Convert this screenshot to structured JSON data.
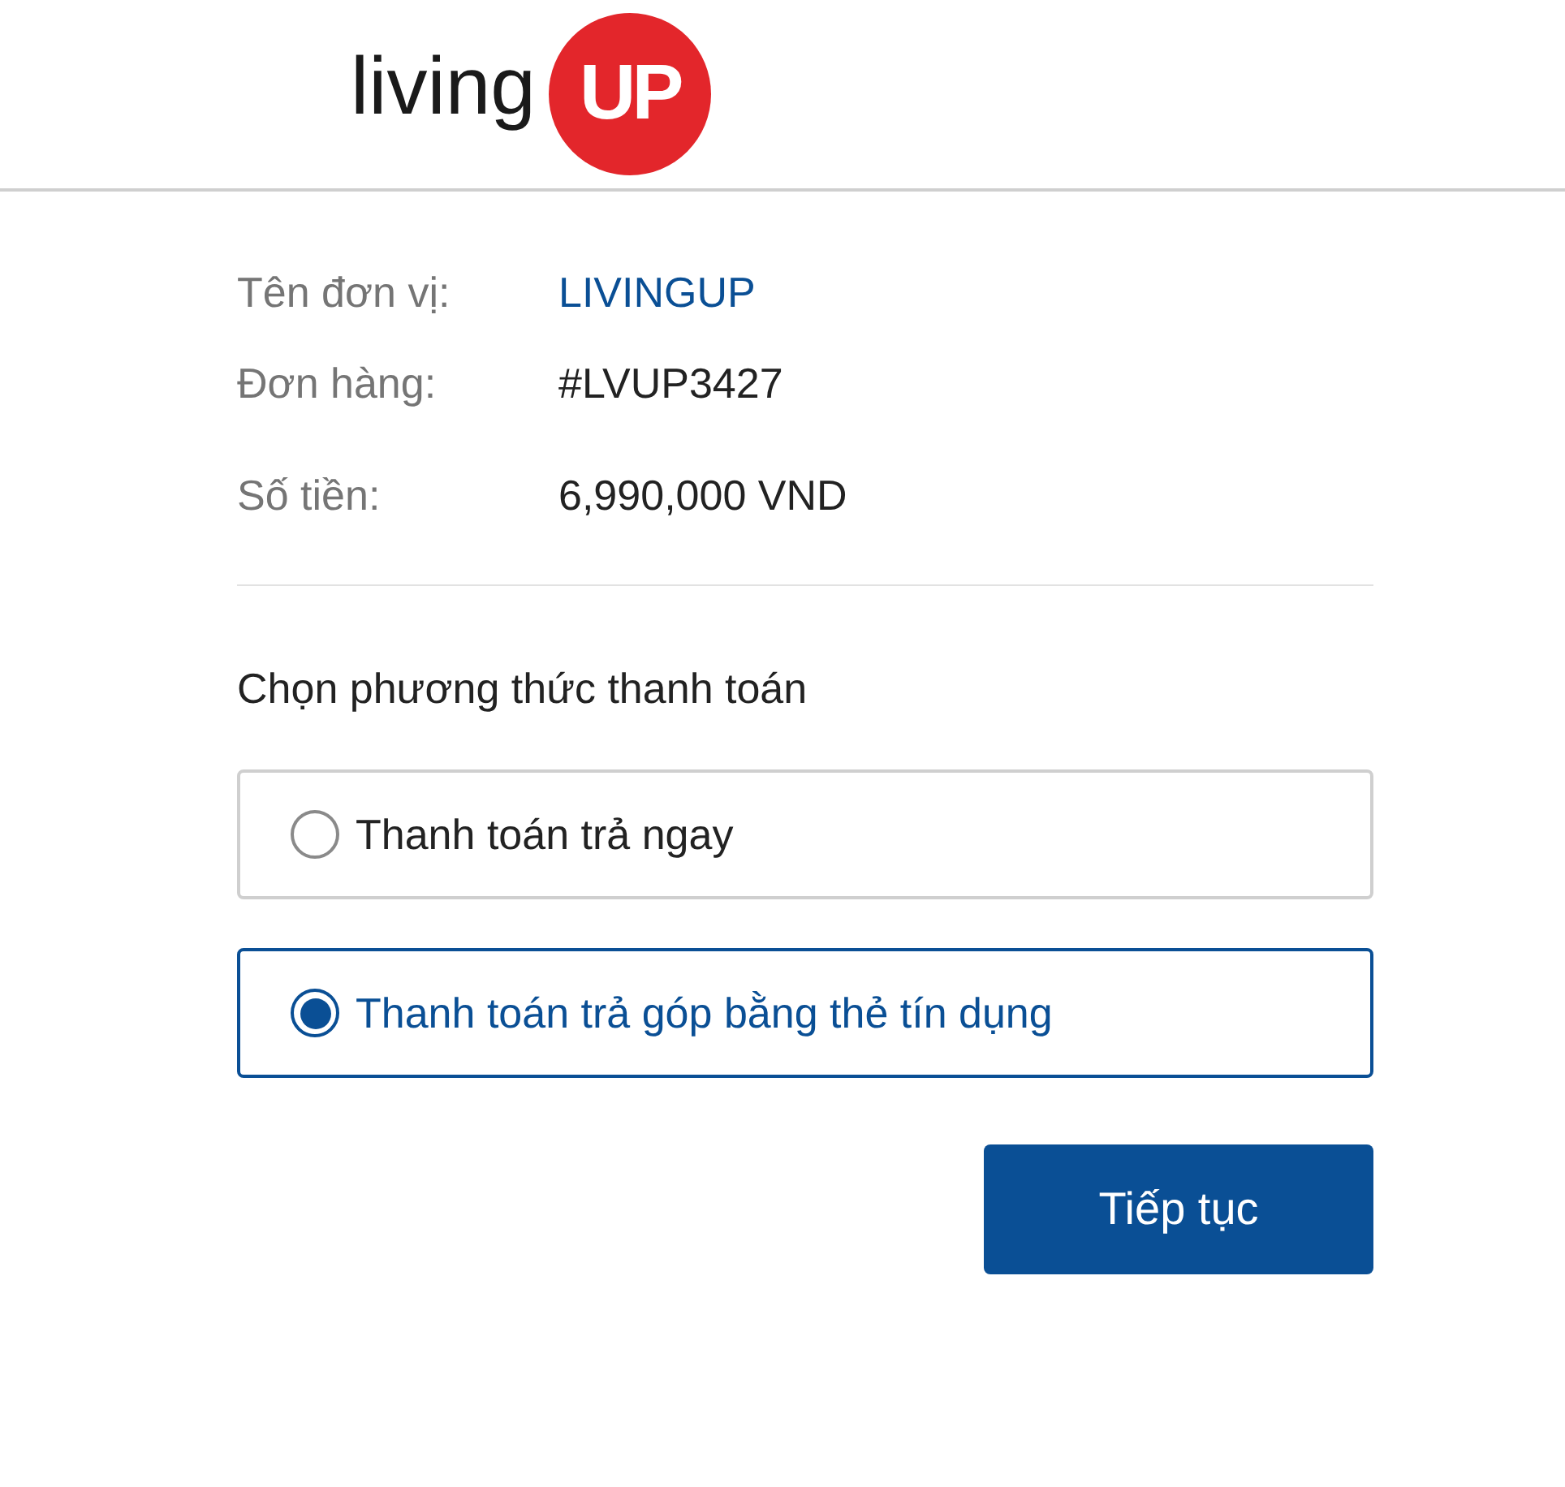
{
  "logo": {
    "word": "living",
    "badge": "UP"
  },
  "details": [
    {
      "label": "Tên đơn vị:",
      "value": "LIVINGUP",
      "kind": "link"
    },
    {
      "label": "Đơn hàng:",
      "value": "#LVUP3427",
      "kind": "text"
    },
    {
      "label": "Số tiền:",
      "value": "6,990,000 VND",
      "kind": "text"
    }
  ],
  "payment": {
    "heading": "Chọn phương thức thanh toán",
    "options": [
      {
        "label": "Thanh toán trả ngay",
        "selected": false
      },
      {
        "label": "Thanh toán trả góp bằng thẻ tín dụng",
        "selected": true
      }
    ]
  },
  "continue_button": "Tiếp tục"
}
